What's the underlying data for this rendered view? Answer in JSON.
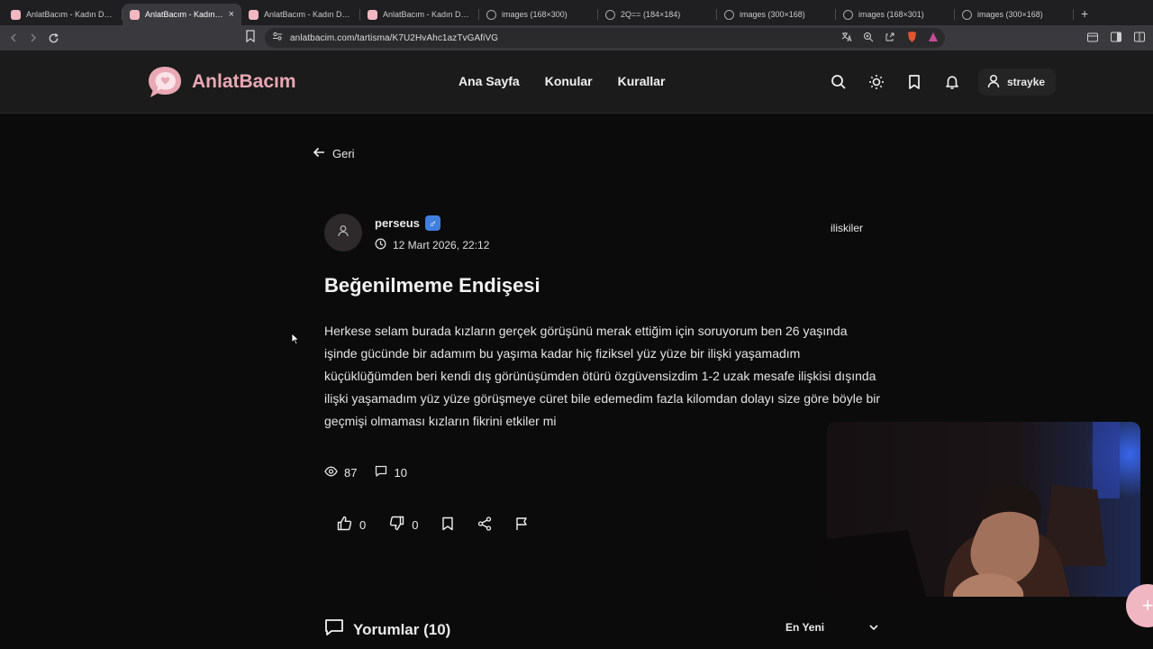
{
  "browser": {
    "tabs": [
      {
        "title": "AnlatBacım - Kadın Destek",
        "favicon": "site",
        "active": false
      },
      {
        "title": "AnlatBacım - Kadın Destek",
        "favicon": "site",
        "active": true
      },
      {
        "title": "AnlatBacım - Kadın Destek",
        "favicon": "site",
        "active": false
      },
      {
        "title": "AnlatBacım - Kadın Destek",
        "favicon": "site",
        "active": false
      },
      {
        "title": "images (168×300)",
        "favicon": "globe",
        "active": false
      },
      {
        "title": "2Q== (184×184)",
        "favicon": "globe",
        "active": false
      },
      {
        "title": "images (300×168)",
        "favicon": "globe",
        "active": false
      },
      {
        "title": "images (168×301)",
        "favicon": "globe",
        "active": false
      },
      {
        "title": "images (300×168)",
        "favicon": "globe",
        "active": false
      }
    ],
    "new_tab": "+",
    "close_glyph": "×",
    "url": "anlatbacim.com/tartisma/K7U2HvAhc1azTvGAfiVG"
  },
  "site": {
    "logo_text": "AnlatBacım",
    "nav": [
      "Ana Sayfa",
      "Konular",
      "Kurallar"
    ],
    "username": "strayke"
  },
  "post": {
    "back_label": "Geri",
    "author": "perseus",
    "gender_symbol": "♂",
    "date": "12 Mart 2026, 22:12",
    "category": "iliskiler",
    "title": "Beğenilmeme Endişesi",
    "body": "Herkese selam burada kızların gerçek görüşünü merak ettiğim için soruyorum ben 26 yaşında işinde gücünde bir adamım bu yaşıma kadar hiç fiziksel yüz yüze bir ilişki yaşamadım küçüklüğümden beri kendi dış görünüşümden ötürü özgüvensizdim 1-2 uzak mesafe ilişkisi dışında ilişki yaşamadım yüz yüze görüşmeye cüret bile edemedim fazla kilomdan dolayı size göre böyle bir geçmişi olmaması kızların fikrini etkiler mi",
    "views": "87",
    "comment_count": "10",
    "likes": "0",
    "dislikes": "0"
  },
  "comments": {
    "heading": "Yorumlar (10)",
    "sort_selected": "En Yeni"
  },
  "fab_label": "+",
  "colors": {
    "brand": "#e9a8b4",
    "gender_badge": "#3f7fe0",
    "background": "#0b0b0b",
    "header": "#1b1b1b"
  }
}
